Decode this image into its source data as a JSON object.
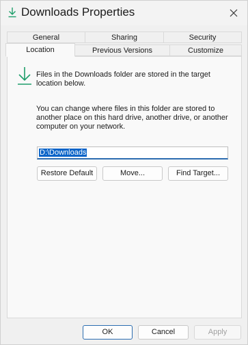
{
  "window": {
    "title": "Downloads Properties",
    "title_icon": "download-arrow-icon",
    "close_icon": "close-icon"
  },
  "tabs_back_row": [
    "General",
    "Sharing",
    "Security"
  ],
  "tabs_front_row": [
    "Location",
    "Previous Versions",
    "Customize"
  ],
  "selected_tab": "Location",
  "location": {
    "icon": "download-arrow-icon",
    "info_line1": "Files in the Downloads folder are stored in the target",
    "info_line2": "location below.",
    "desc_line1": "You can change where files in this folder are stored to",
    "desc_line2": "another place on this hard drive, another drive, or another",
    "desc_line3": "computer on your network.",
    "path_value": "D:\\Downloads",
    "restore_default": "Restore Default",
    "move": "Move...",
    "find_target": "Find Target..."
  },
  "footer": {
    "ok": "OK",
    "cancel": "Cancel",
    "apply": "Apply"
  },
  "colors": {
    "accent": "#2b6cb0",
    "icon_green": "#1e9e6a"
  }
}
